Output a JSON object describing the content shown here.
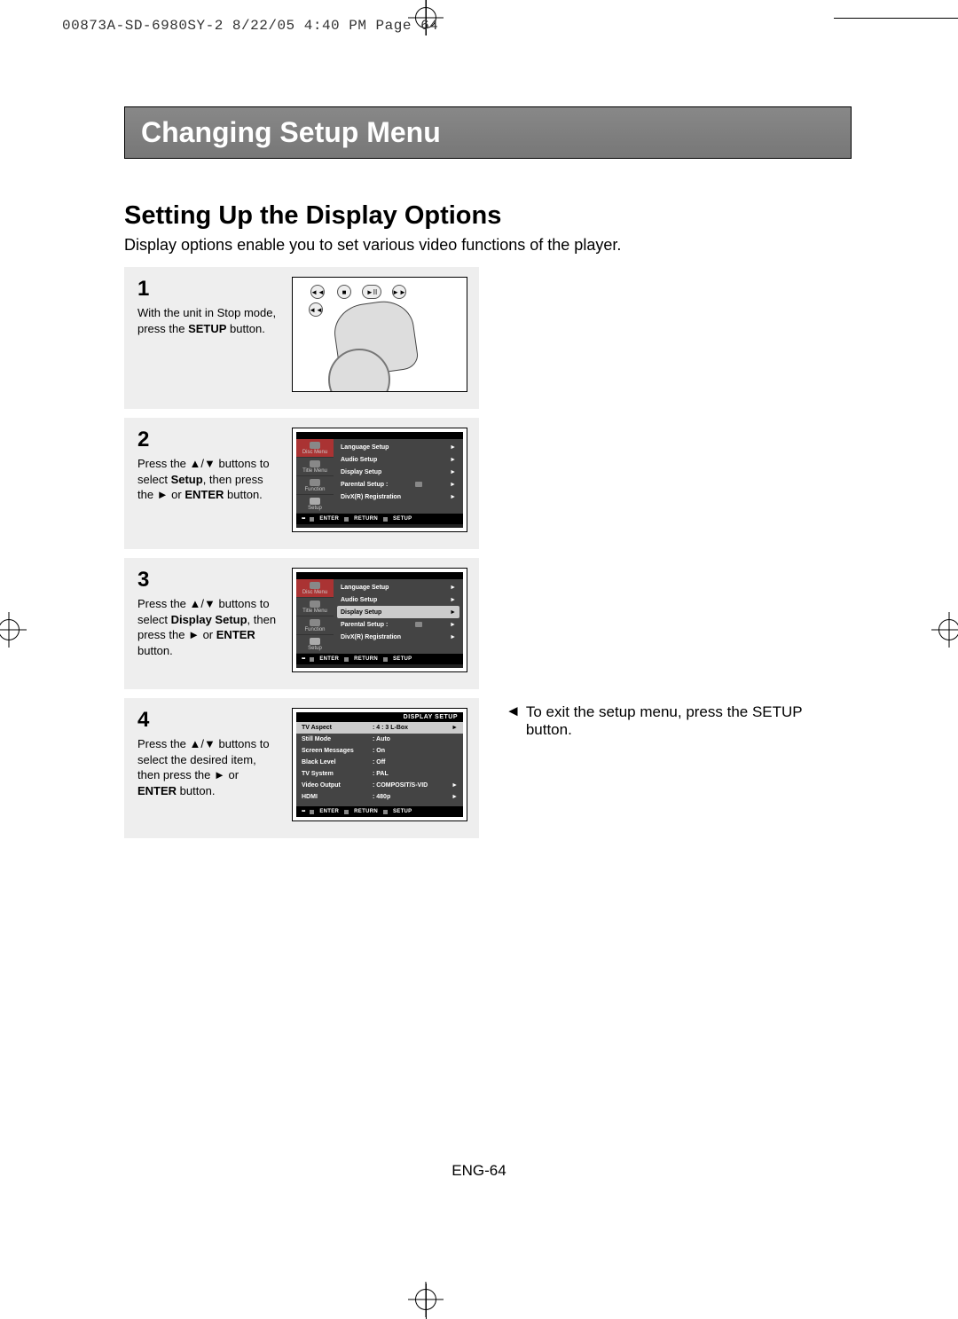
{
  "header": {
    "imposition_line": "00873A-SD-6980SY-2  8/22/05 4:40 PM  Page 64"
  },
  "title_bar": "Changing Setup Menu",
  "section_title": "Setting Up the Display Options",
  "intro": "Display options enable you to set various video functions of the player.",
  "steps": {
    "s1": {
      "num": "1",
      "pre": "With the unit in Stop mode, press the ",
      "bold": "SETUP",
      "post": " button."
    },
    "s2": {
      "num": "2",
      "a": "Press the ",
      "b": " buttons to select ",
      "bold1": "Setup",
      "c": ", then press the ",
      "d": " or ",
      "bold2": "ENTER",
      "e": " button."
    },
    "s3": {
      "num": "3",
      "a": "Press the ",
      "b": " buttons to select ",
      "bold1": "Display Setup",
      "c": ", then press the ",
      "d": " or ",
      "bold2": "ENTER",
      "e": " button."
    },
    "s4": {
      "num": "4",
      "a": "Press the ",
      "b": " buttons to select the desired item, then press the ",
      "c": " or ",
      "bold2": "ENTER",
      "d": " button."
    }
  },
  "osd": {
    "side": {
      "i1": "Disc Menu",
      "i2": "Title Menu",
      "i3": "Function",
      "i4": "Setup"
    },
    "rows": {
      "r1": "Language Setup",
      "r2": "Audio Setup",
      "r3": "Display Setup",
      "r4": "Parental Setup  :",
      "r5": "DivX(R) Registration"
    },
    "foot": {
      "enter": "ENTER",
      "ret": "RETURN",
      "setup": "SETUP"
    }
  },
  "display_setup": {
    "title": "DISPLAY SETUP",
    "rows": {
      "r1": {
        "label": "TV Aspect",
        "value": ": 4 : 3 L-Box"
      },
      "r2": {
        "label": "Still Mode",
        "value": ": Auto"
      },
      "r3": {
        "label": "Screen Messages",
        "value": ": On"
      },
      "r4": {
        "label": "Black Level",
        "value": ": Off"
      },
      "r5": {
        "label": "TV System",
        "value": ": PAL"
      },
      "r6": {
        "label": "Video Output",
        "value": ": COMPOSIT/S-VID"
      },
      "r7": {
        "label": "HDMI",
        "value": ": 480p"
      }
    }
  },
  "exit_note": "To exit the setup menu, press the SETUP button.",
  "footer": "ENG-64"
}
